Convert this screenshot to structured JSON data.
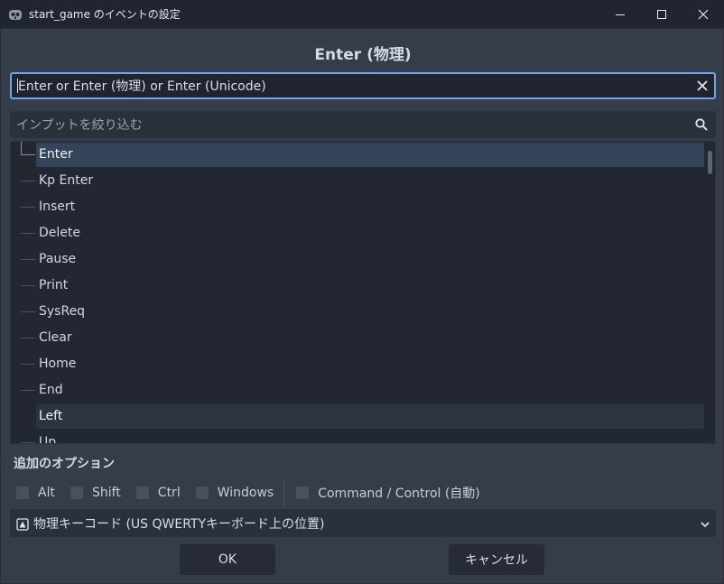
{
  "window": {
    "title": "start_game のイベントの設定",
    "minimize_icon": "minimize-icon",
    "maximize_icon": "maximize-icon",
    "close_icon": "close-icon"
  },
  "dialog": {
    "heading": "Enter (物理)",
    "event_input": {
      "value": "Enter or Enter (物理) or Enter (Unicode)"
    },
    "filter_input": {
      "placeholder": "インプットを絞り込む"
    },
    "key_list": [
      {
        "label": "Enter",
        "state": "selected"
      },
      {
        "label": "Kp Enter",
        "state": "normal"
      },
      {
        "label": "Insert",
        "state": "normal"
      },
      {
        "label": "Delete",
        "state": "normal"
      },
      {
        "label": "Pause",
        "state": "normal"
      },
      {
        "label": "Print",
        "state": "normal"
      },
      {
        "label": "SysReq",
        "state": "normal"
      },
      {
        "label": "Clear",
        "state": "normal"
      },
      {
        "label": "Home",
        "state": "normal"
      },
      {
        "label": "End",
        "state": "normal"
      },
      {
        "label": "Left",
        "state": "hover"
      },
      {
        "label": "Up",
        "state": "normal"
      }
    ],
    "options": {
      "title": "追加のオプション",
      "modifiers": [
        {
          "label": "Alt",
          "checked": false
        },
        {
          "label": "Shift",
          "checked": false
        },
        {
          "label": "Ctrl",
          "checked": false
        },
        {
          "label": "Windows",
          "checked": false
        }
      ],
      "command": {
        "label": "Command / Control (自動)",
        "checked": false
      }
    },
    "keycode_mode": {
      "selected": "物理キーコード (US QWERTYキーボード上の位置)"
    },
    "buttons": {
      "ok": "OK",
      "cancel": "キャンセル"
    }
  },
  "colors": {
    "accent": "#6fa7e6",
    "selection": "#34445a",
    "background": "#363d4a"
  }
}
